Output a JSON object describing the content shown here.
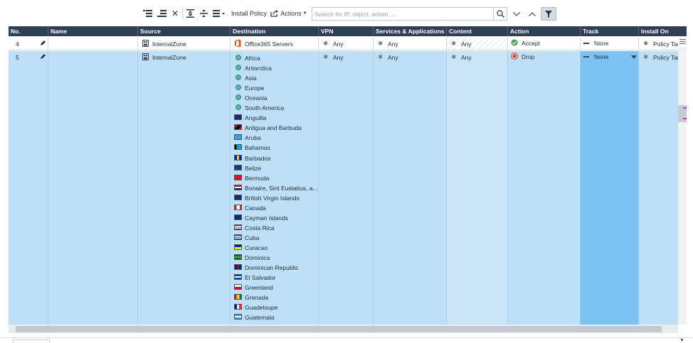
{
  "toolbar": {
    "install_policy_label": "Install Policy",
    "actions_label": "Actions",
    "search_placeholder": "Search for IP, object, action, ..."
  },
  "columns": [
    {
      "key": "no",
      "label": "No."
    },
    {
      "key": "name",
      "label": "Name"
    },
    {
      "key": "source",
      "label": "Source"
    },
    {
      "key": "destination",
      "label": "Destination"
    },
    {
      "key": "vpn",
      "label": "VPN"
    },
    {
      "key": "services",
      "label": "Services & Applications"
    },
    {
      "key": "content",
      "label": "Content"
    },
    {
      "key": "action",
      "label": "Action"
    },
    {
      "key": "track",
      "label": "Track"
    },
    {
      "key": "install_on",
      "label": "Install On"
    }
  ],
  "rows": [
    {
      "no": "4",
      "source": "InternalZone",
      "destination": "Office365 Servers",
      "vpn": "Any",
      "services": "Any",
      "content": "Any",
      "action": "Accept",
      "track": "None",
      "install_on": "Policy Targets"
    },
    {
      "no": "5",
      "source": "InternalZone",
      "vpn": "Any",
      "services": "Any",
      "content": "Any",
      "action": "Drop",
      "track": "None",
      "install_on": "Policy Targets",
      "destinations": [
        {
          "label": "Africa",
          "icon": "globe-icon"
        },
        {
          "label": "Antarctica",
          "icon": "globe-icon"
        },
        {
          "label": "Asia",
          "icon": "globe-icon"
        },
        {
          "label": "Europe",
          "icon": "globe-icon"
        },
        {
          "label": "Oceania",
          "icon": "globe-icon"
        },
        {
          "label": "South America",
          "icon": "globe-icon"
        },
        {
          "label": "Anguilla",
          "icon": "flag-icon"
        },
        {
          "label": "Antigua and Barbuda",
          "icon": "flag-icon"
        },
        {
          "label": "Aruba",
          "icon": "flag-icon"
        },
        {
          "label": "Bahamas",
          "icon": "flag-icon"
        },
        {
          "label": "Barbados",
          "icon": "flag-icon"
        },
        {
          "label": "Belize",
          "icon": "flag-icon"
        },
        {
          "label": "Bermuda",
          "icon": "flag-icon"
        },
        {
          "label": "Bonaire, Sint Eustatius, a...",
          "icon": "flag-icon"
        },
        {
          "label": "British Virgin Islands",
          "icon": "flag-icon"
        },
        {
          "label": "Canada",
          "icon": "flag-icon"
        },
        {
          "label": "Cayman Islands",
          "icon": "flag-icon"
        },
        {
          "label": "Costa Rica",
          "icon": "flag-icon"
        },
        {
          "label": "Cuba",
          "icon": "flag-icon"
        },
        {
          "label": "Curacao",
          "icon": "flag-icon"
        },
        {
          "label": "Dominica",
          "icon": "flag-icon"
        },
        {
          "label": "Dominican Republic",
          "icon": "flag-icon"
        },
        {
          "label": "El Salvador",
          "icon": "flag-icon"
        },
        {
          "label": "Greenland",
          "icon": "flag-icon"
        },
        {
          "label": "Grenada",
          "icon": "flag-icon"
        },
        {
          "label": "Guadeloupe",
          "icon": "flag-icon"
        },
        {
          "label": "Guatemala",
          "icon": "flag-icon"
        }
      ]
    }
  ],
  "colors": {
    "header_bg": "#2f3e53",
    "selected_row": "#bde0f8",
    "track_cell": "#7cc2f2",
    "accept": "#44a047",
    "drop": "#e53935"
  }
}
